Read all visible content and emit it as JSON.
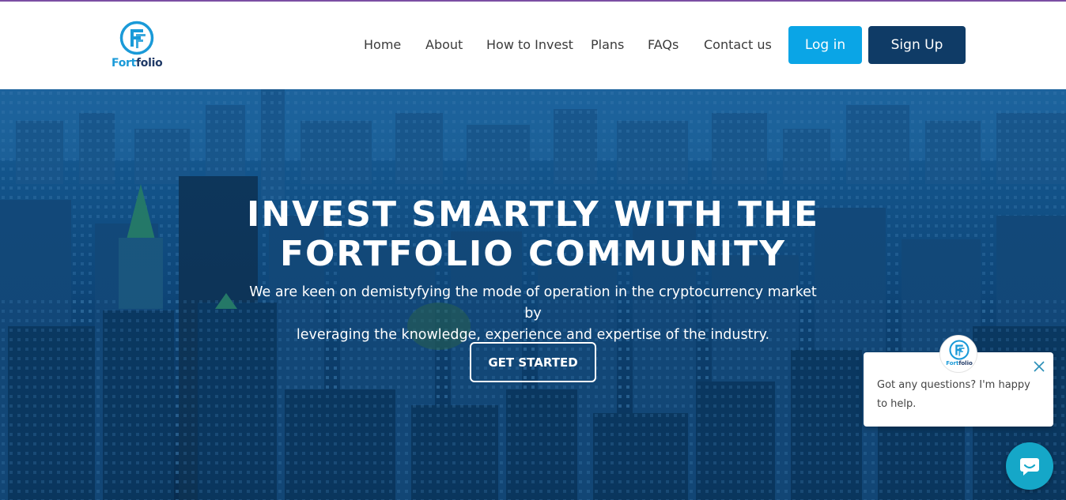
{
  "brand": {
    "name_part1": "Fort",
    "name_part2": "folio",
    "primary_color": "#1a9ad8",
    "dark_color": "#203a67"
  },
  "nav": {
    "items": [
      "Home",
      "About",
      "How to Invest",
      "Plans",
      "FAQs",
      "Contact us"
    ]
  },
  "auth": {
    "login_label": "Log in",
    "signup_label": "Sign Up"
  },
  "hero": {
    "title_line1": "INVEST SMARTLY WITH THE",
    "title_line2": "FORTFOLIO COMMUNITY",
    "subtitle_line1": "We are keen on demistyfying the mode of operation in the cryptocurrency market by",
    "subtitle_line2": "leveraging the knowledge, experience and expertise of the industry.",
    "cta_label": "GET STARTED"
  },
  "chat": {
    "avatar_part1": "Fort",
    "avatar_part2": "folio",
    "message": "Got any questions? I'm happy to help.",
    "bubble_color": "#15a7c8",
    "icons": [
      "close-icon",
      "chat-icon"
    ]
  }
}
